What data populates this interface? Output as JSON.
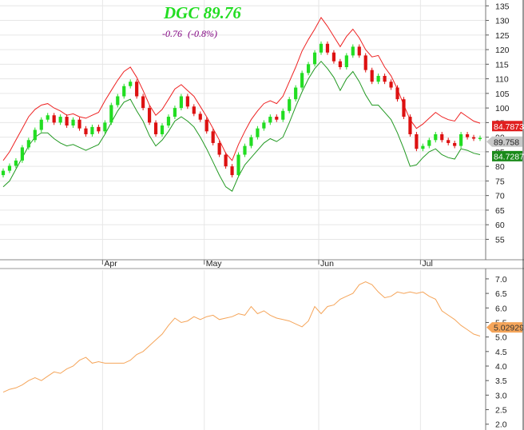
{
  "header": {
    "symbol_price": "DGC 89.76",
    "change": "-0.76",
    "change_pct": "(-0.8%)"
  },
  "colors": {
    "up": "#22dd22",
    "down": "#dd1111",
    "upper_band": "#ee2222",
    "lower_band": "#229922",
    "indicator": "#f5a55a",
    "grid": "#e6e6e6",
    "last_price_badge": "#c8c8c8"
  },
  "badges": {
    "upper": "84.7873",
    "last": "89.758",
    "lower": "84.7287",
    "indicator": "5.02929"
  },
  "chart_data": [
    {
      "type": "candlestick",
      "title": "DGC 89.76",
      "xlabel": "",
      "ylabel": "",
      "ylim": [
        48,
        137
      ],
      "y_ticks": [
        55,
        60,
        65,
        70,
        75,
        80,
        85,
        90,
        95,
        100,
        105,
        110,
        115,
        120,
        125,
        130,
        135
      ],
      "x_ticks": [
        "Apr",
        "May",
        "Jun",
        "Jul"
      ],
      "grid": true,
      "series": [
        {
          "role": "candles",
          "close": [
            78.5,
            80.2,
            82.0,
            86.5,
            89.0,
            92.5,
            96.0,
            97.5,
            95.0,
            97.0,
            94.0,
            96.0,
            93.0,
            91.0,
            93.5,
            92.0,
            95.0,
            101.0,
            104.0,
            107.5,
            109.0,
            104.0,
            100.0,
            95.0,
            91.0,
            94.0,
            97.0,
            100.0,
            104.0,
            100.5,
            98.0,
            96.0,
            92.0,
            88.0,
            84.0,
            80.0,
            77.0,
            84.0,
            87.0,
            90.0,
            93.0,
            95.0,
            97.0,
            96.0,
            99.0,
            103.0,
            107.0,
            112.0,
            115.0,
            119.0,
            122.0,
            119.0,
            116.0,
            114.0,
            118.0,
            121.0,
            118.0,
            113.0,
            109.0,
            111.0,
            109.0,
            107.0,
            103.0,
            97.0,
            91.0,
            86.0,
            87.0,
            89.0,
            91.0,
            89.0,
            88.0,
            87.0,
            91.0,
            90.0,
            89.5,
            89.76
          ]
        },
        {
          "role": "upper-band",
          "name": "84.7873",
          "values": [
            82.0,
            85.0,
            89.0,
            93.0,
            97.0,
            99.5,
            101.0,
            101.5,
            100.0,
            99.0,
            97.5,
            98.0,
            97.0,
            96.5,
            97.5,
            98.5,
            102.5,
            106.0,
            109.5,
            112.5,
            114.0,
            110.5,
            106.0,
            101.0,
            97.5,
            99.5,
            103.0,
            106.5,
            108.0,
            106.0,
            104.0,
            100.5,
            97.0,
            93.0,
            89.0,
            84.5,
            82.0,
            87.5,
            92.0,
            96.0,
            99.0,
            101.5,
            102.5,
            101.5,
            104.0,
            109.0,
            114.0,
            119.5,
            123.5,
            127.0,
            131.0,
            128.0,
            124.5,
            121.0,
            124.5,
            127.0,
            124.0,
            120.0,
            117.5,
            118.0,
            114.0,
            111.0,
            106.5,
            101.0,
            96.0,
            93.0,
            94.5,
            96.5,
            98.5,
            97.0,
            96.0,
            95.5,
            98.5,
            97.0,
            95.5,
            94.8
          ]
        },
        {
          "role": "lower-band",
          "name": "84.7287",
          "values": [
            73.0,
            75.0,
            79.0,
            83.0,
            87.0,
            90.0,
            91.5,
            91.5,
            89.5,
            88.0,
            87.0,
            87.5,
            86.5,
            85.5,
            86.5,
            87.5,
            91.0,
            95.0,
            99.0,
            102.0,
            103.0,
            99.0,
            95.5,
            90.5,
            87.0,
            89.0,
            92.0,
            95.5,
            97.0,
            95.5,
            93.5,
            90.0,
            86.0,
            81.5,
            77.0,
            73.0,
            71.5,
            76.5,
            80.5,
            83.0,
            85.5,
            88.0,
            89.5,
            88.5,
            90.0,
            95.0,
            100.5,
            105.5,
            110.0,
            113.5,
            116.0,
            113.5,
            110.5,
            106.0,
            110.0,
            112.5,
            109.0,
            104.5,
            101.0,
            101.0,
            98.5,
            96.0,
            91.5,
            86.0,
            80.0,
            80.5,
            83.0,
            85.0,
            86.0,
            84.0,
            83.0,
            82.5,
            86.0,
            85.5,
            84.5,
            84.0
          ]
        }
      ]
    },
    {
      "type": "line",
      "title": "",
      "xlabel": "",
      "ylabel": "",
      "ylim": [
        1.8,
        7.3
      ],
      "y_ticks": [
        2.0,
        2.5,
        3.0,
        3.5,
        4.0,
        4.5,
        5.0,
        5.5,
        6.0,
        6.5,
        7.0
      ],
      "grid": false,
      "series": [
        {
          "values": [
            3.1,
            3.2,
            3.25,
            3.35,
            3.5,
            3.6,
            3.5,
            3.65,
            3.8,
            3.75,
            3.9,
            4.0,
            4.2,
            4.3,
            4.1,
            4.15,
            4.1,
            4.1,
            4.1,
            4.1,
            4.2,
            4.4,
            4.5,
            4.7,
            4.9,
            5.1,
            5.4,
            5.65,
            5.5,
            5.55,
            5.7,
            5.6,
            5.7,
            5.75,
            5.6,
            5.65,
            5.7,
            5.8,
            5.75,
            6.05,
            5.8,
            5.9,
            5.75,
            5.65,
            5.6,
            5.55,
            5.45,
            5.35,
            5.55,
            6.05,
            5.8,
            6.05,
            6.1,
            6.3,
            6.4,
            6.5,
            6.8,
            6.9,
            6.8,
            6.55,
            6.35,
            6.4,
            6.55,
            6.5,
            6.55,
            6.5,
            6.55,
            6.4,
            6.3,
            5.9,
            5.75,
            5.6,
            5.4,
            5.25,
            5.1,
            5.03
          ]
        }
      ]
    }
  ]
}
